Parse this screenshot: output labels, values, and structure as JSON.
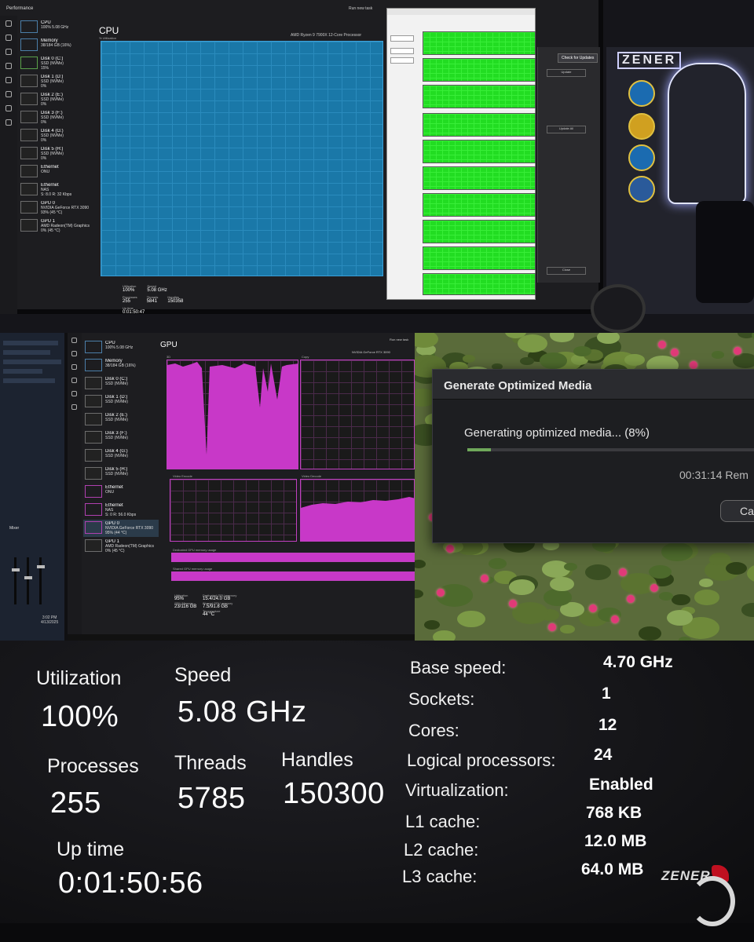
{
  "panel_cpu": {
    "window_title": "Performance",
    "run_task": "Run new task",
    "devices": [
      {
        "name": "CPU",
        "detail": "100% 5.08 GHz",
        "kind": "blue"
      },
      {
        "name": "Memory",
        "detail": "38/184 GB (16%)",
        "kind": "blue"
      },
      {
        "name": "Disk 0 (C:)",
        "detail": "SSD (NVMe)",
        "pct": "15%",
        "kind": "green"
      },
      {
        "name": "Disk 1 (D:)",
        "detail": "SSD (NVMe)",
        "pct": "0%",
        "kind": "gray"
      },
      {
        "name": "Disk 2 (E:)",
        "detail": "SSD (NVMe)",
        "pct": "0%",
        "kind": "gray"
      },
      {
        "name": "Disk 3 (F:)",
        "detail": "SSD (NVMe)",
        "pct": "0%",
        "kind": "gray"
      },
      {
        "name": "Disk 4 (G:)",
        "detail": "SSD (NVMe)",
        "pct": "0%",
        "kind": "gray"
      },
      {
        "name": "Disk 5 (H:)",
        "detail": "SSD (NVMe)",
        "pct": "0%",
        "kind": "gray"
      },
      {
        "name": "Ethernet",
        "detail": "ONU",
        "pct": "",
        "kind": "gray"
      },
      {
        "name": "Ethernet",
        "detail": "NAS",
        "pct": "S: 8.0 R: 32 Kbps",
        "kind": "gray"
      },
      {
        "name": "GPU 0",
        "detail": "NVIDIA GeForce RTX 3090",
        "pct": "93% (45 °C)",
        "kind": "gray"
      },
      {
        "name": "GPU 1",
        "detail": "AMD Radeon(TM) Graphics",
        "pct": "0% (45 °C)",
        "kind": "gray"
      }
    ],
    "heading": "CPU",
    "sub": "% Utilization",
    "model": "AMD Ryzen 9 7900X 12-Core Processor",
    "mini": {
      "util_label": "Utilization",
      "util": "100%",
      "speed_label": "Speed",
      "speed": "5.08 GHz",
      "proc_label": "Processes",
      "proc": "255",
      "thr_label": "Threads",
      "thr": "5841",
      "hnd_label": "Handles",
      "hnd": "150358",
      "up_label": "Up time",
      "up": "0:01:50:47"
    },
    "check_updates": "Check for Updates",
    "update_btn": "Update",
    "update_all": "Update All",
    "clear_btn": "Close",
    "sign_text": "ZENER"
  },
  "panel_gpu": {
    "mixer_label": "Mixer",
    "clock_time": "3:02 PM",
    "clock_date": "4/13/2025",
    "run_task": "Run new task",
    "heading": "GPU",
    "model": "NVIDIA GeForce RTX 3090",
    "devices": [
      {
        "name": "CPU",
        "detail": "100% 5.08 GHz",
        "kind": "blue"
      },
      {
        "name": "Memory",
        "detail": "38/184 GB (16%)",
        "kind": "blue"
      },
      {
        "name": "Disk 0 (C:)",
        "detail": "SSD (NVMe)",
        "pct": "",
        "kind": "gray"
      },
      {
        "name": "Disk 1 (D:)",
        "detail": "SSD (NVMe)",
        "pct": "",
        "kind": "gray"
      },
      {
        "name": "Disk 2 (E:)",
        "detail": "SSD (NVMe)",
        "pct": "",
        "kind": "gray"
      },
      {
        "name": "Disk 3 (F:)",
        "detail": "SSD (NVMe)",
        "pct": "",
        "kind": "gray"
      },
      {
        "name": "Disk 4 (G:)",
        "detail": "SSD (NVMe)",
        "pct": "",
        "kind": "gray"
      },
      {
        "name": "Disk 5 (H:)",
        "detail": "SSD (NVMe)",
        "pct": "",
        "kind": "gray"
      },
      {
        "name": "Ethernet",
        "detail": "ONU",
        "pct": "",
        "kind": "mag"
      },
      {
        "name": "Ethernet",
        "detail": "NAS",
        "pct": "S: 0 R: 56.0 Kbps",
        "kind": "mag"
      },
      {
        "name": "GPU 0",
        "detail": "NVIDIA GeForce RTX 3090",
        "pct": "95% (44 °C)",
        "kind": "mag",
        "sel": true
      },
      {
        "name": "GPU 1",
        "detail": "AMD Radeon(TM) Graphics",
        "pct": "0% (45 °C)",
        "kind": "gray"
      }
    ],
    "graph_labels": {
      "g3d": "3D",
      "copy": "Copy",
      "venc": "Video Encode",
      "vdec": "Video Decode",
      "dedicated": "Dedicated GPU memory usage",
      "shared": "Shared GPU memory usage"
    },
    "stats": {
      "util_label": "Utilization",
      "util": "95%",
      "ded_label": "Dedicated GPU memory",
      "ded": "15.4/24.0 GB",
      "gpumem_label": "GPU Memory",
      "gpumem": "23/116 GB",
      "shared_label": "Shared GPU memory",
      "shared": "7.5/91.8 GB",
      "temp_label": "Temperature",
      "temp": "44 °C"
    }
  },
  "panel_resolve": {
    "title": "Generate Optimized Media",
    "message": "Generating optimized media... (8%)",
    "progress": 0.08,
    "remaining": "00:31:14 Rem",
    "cancel": "Canc"
  },
  "panel_stats": {
    "util_label": "Utilization",
    "util": "100%",
    "speed_label": "Speed",
    "speed": "5.08 GHz",
    "proc_label": "Processes",
    "proc": "255",
    "thr_label": "Threads",
    "thr": "5785",
    "hnd_label": "Handles",
    "hnd": "150300",
    "up_label": "Up time",
    "up": "0:01:50:56",
    "kv": [
      {
        "k": "Base speed:",
        "v": "4.70 GHz"
      },
      {
        "k": "Sockets:",
        "v": "1"
      },
      {
        "k": "Cores:",
        "v": "12"
      },
      {
        "k": "Logical processors:",
        "v": "24"
      },
      {
        "k": "Virtualization:",
        "v": "Enabled"
      },
      {
        "k": "L1 cache:",
        "v": "768 KB"
      },
      {
        "k": "L2 cache:",
        "v": "12.0 MB"
      },
      {
        "k": "L3 cache:",
        "v": "64.0 MB"
      }
    ],
    "logo_text": "ZENER"
  },
  "colors": {
    "cpu_graph": "#1a78a8",
    "gpu_graph": "#c838c8",
    "core_graph": "#22dd22",
    "progress": "#6fa85a"
  }
}
